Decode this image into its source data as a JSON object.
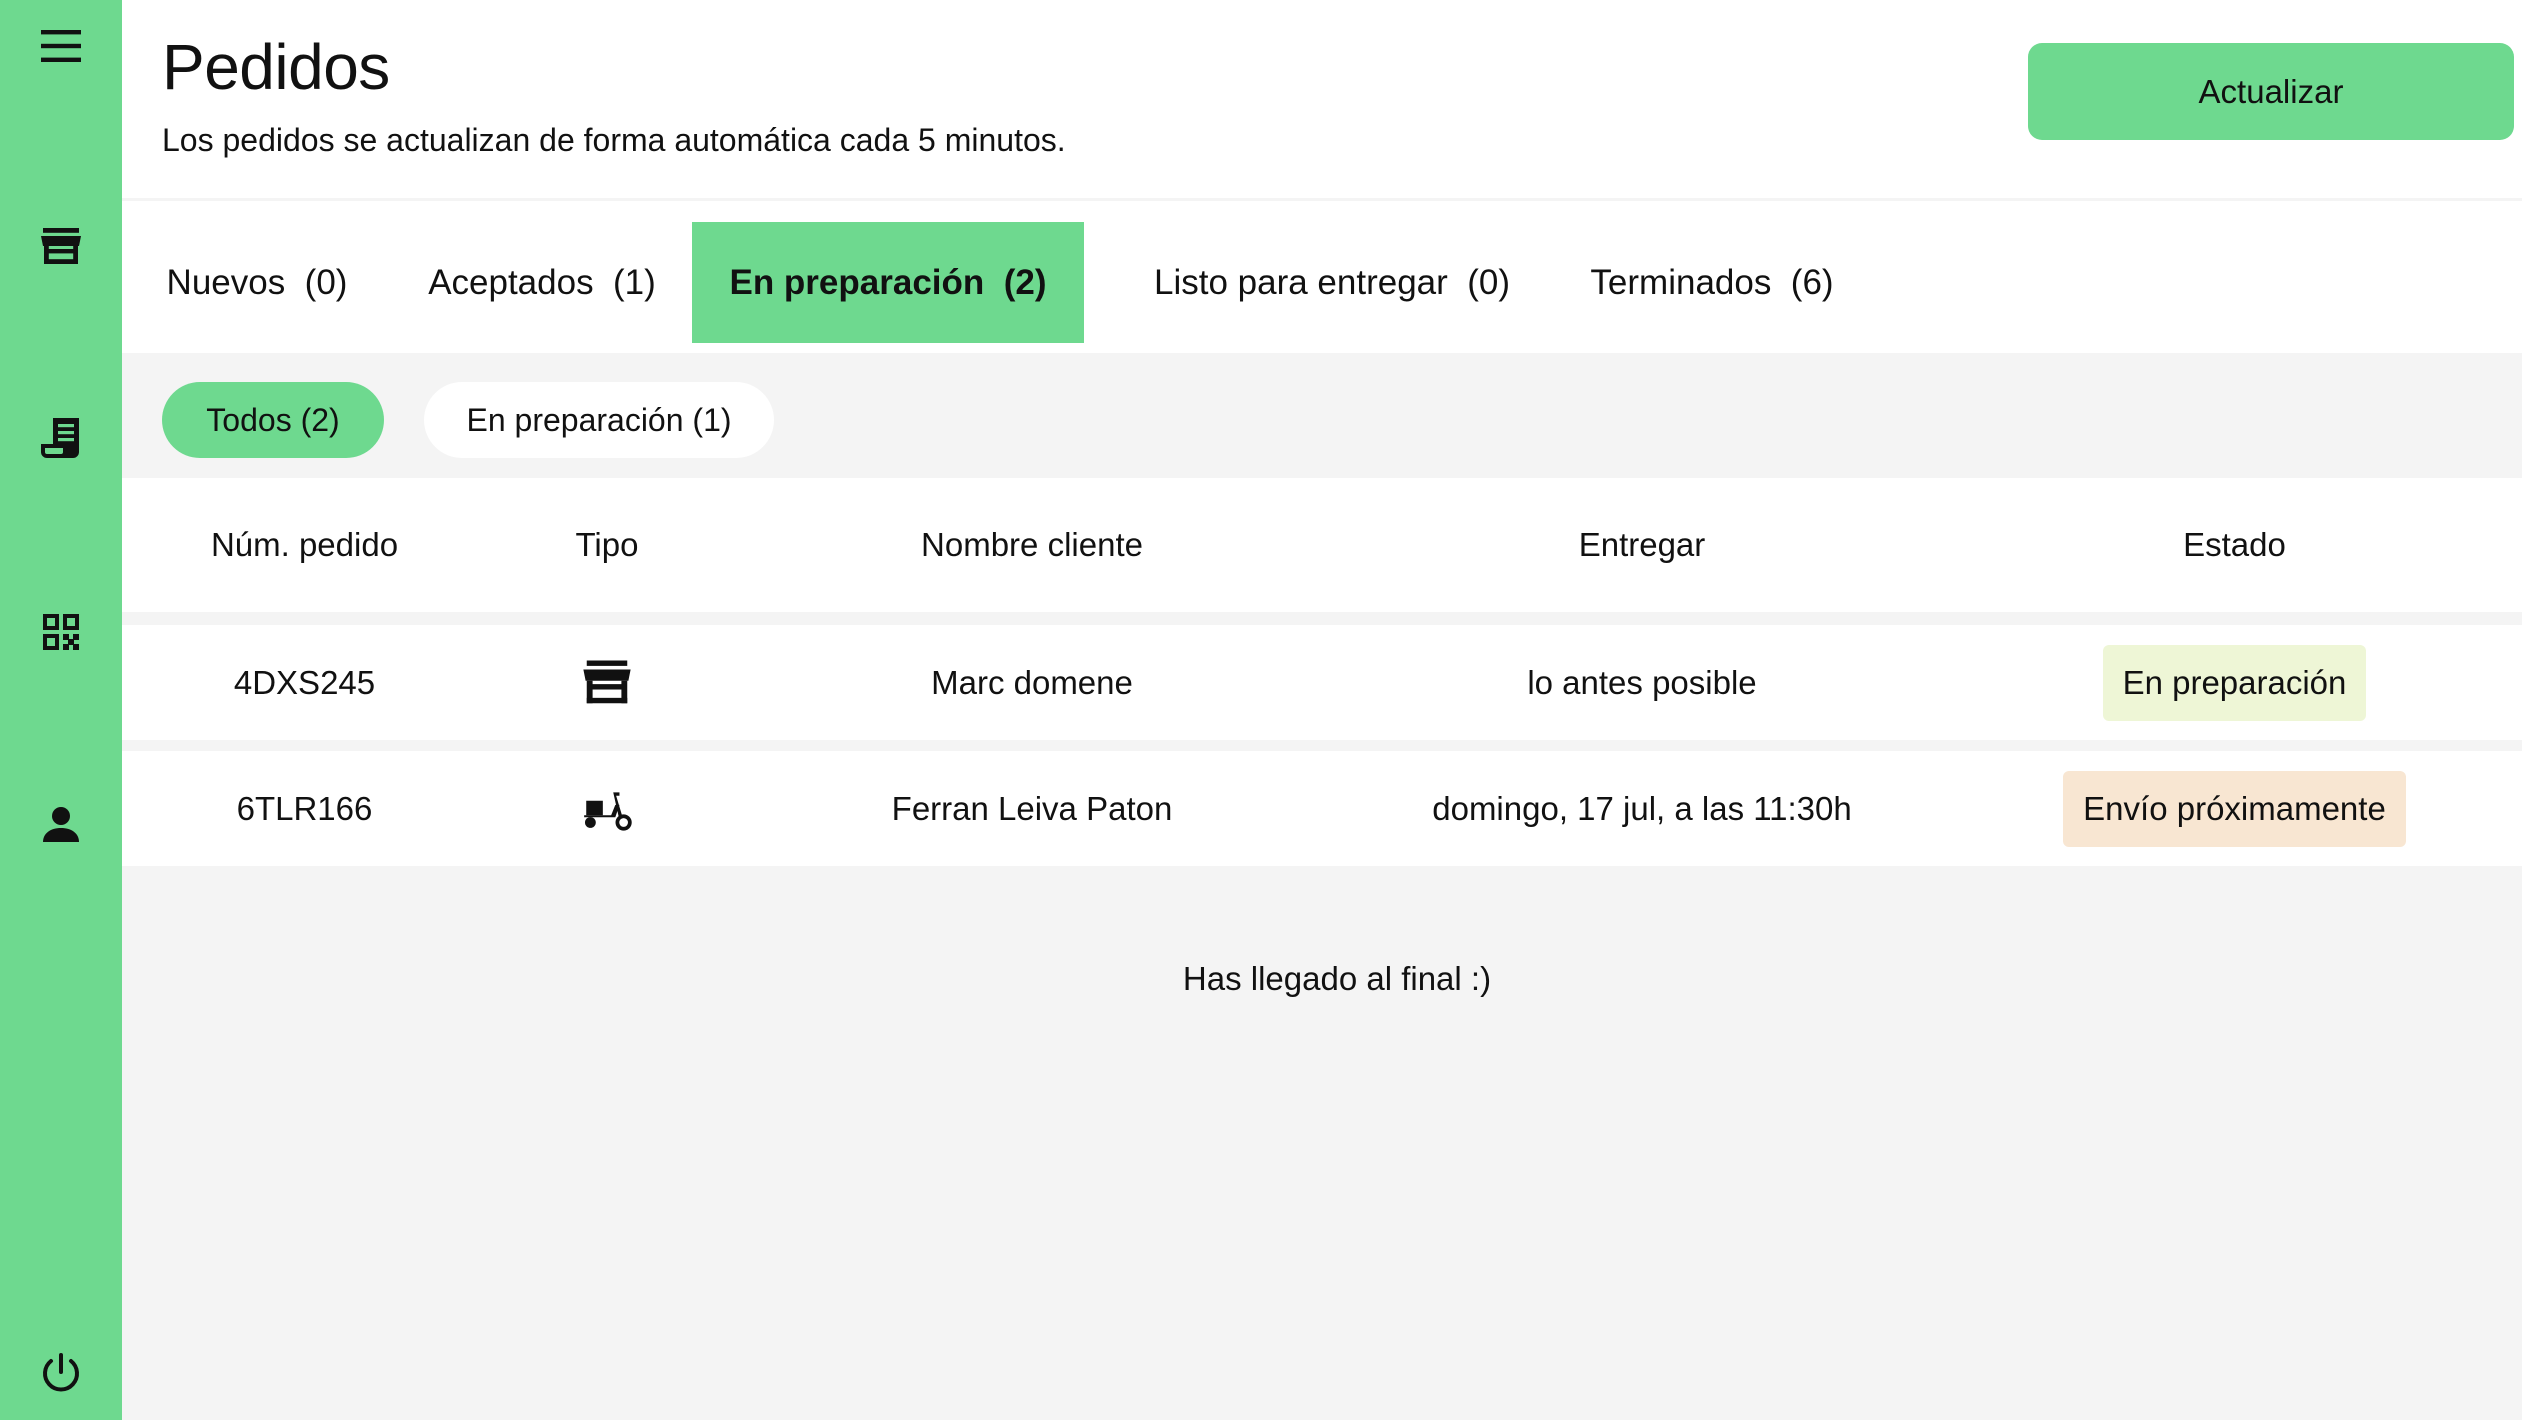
{
  "sidebar": {
    "items": [
      {
        "icon": "menu-icon"
      },
      {
        "icon": "store-icon"
      },
      {
        "icon": "receipt-icon"
      },
      {
        "icon": "qr-code-icon"
      },
      {
        "icon": "user-icon"
      },
      {
        "icon": "power-icon"
      }
    ]
  },
  "header": {
    "title": "Pedidos",
    "subtitle": "Los pedidos se actualizan de forma automática cada 5 minutos.",
    "refresh_label": "Actualizar"
  },
  "tabs": [
    {
      "label": "Nuevos  (0)"
    },
    {
      "label": "Aceptados  (1)"
    },
    {
      "label": "En preparación  (2)",
      "active": true
    },
    {
      "label": "Listo para entregar  (0)"
    },
    {
      "label": "Terminados  (6)"
    }
  ],
  "filters": [
    {
      "label": "Todos (2)",
      "selected": true
    },
    {
      "label": "En preparación (1)",
      "selected": false
    }
  ],
  "table": {
    "columns": [
      "Núm. pedido",
      "Tipo",
      "Nombre cliente",
      "Entregar",
      "Estado"
    ],
    "rows": [
      {
        "order": "4DXS245",
        "type_icon": "store-icon",
        "customer": "Marc domene",
        "deliver": "lo antes posible",
        "status": "En preparación",
        "status_color": "#eef6d6"
      },
      {
        "order": "6TLR166",
        "type_icon": "scooter-icon",
        "customer": "Ferran Leiva Paton",
        "deliver": "domingo, 17 jul, a las 11:30h",
        "status": "Envío próximamente",
        "status_color": "#f8e6d2"
      }
    ]
  },
  "footer": {
    "end_text": "Has llegado al final :)"
  },
  "colors": {
    "accent": "#6ed98f",
    "background": "#f4f4f4"
  }
}
